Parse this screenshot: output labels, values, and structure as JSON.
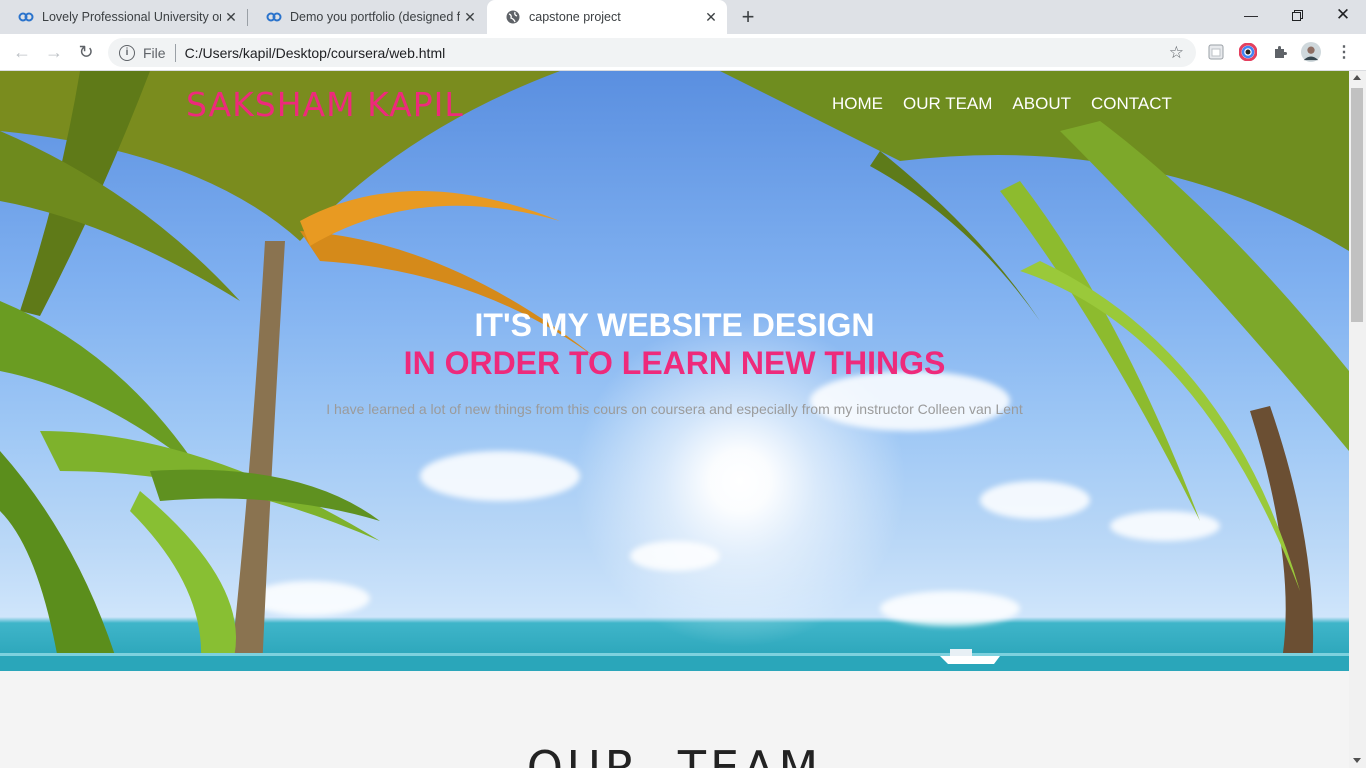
{
  "browser": {
    "tabs": [
      {
        "title": "Lovely Professional University on",
        "icon": "coursera-icon"
      },
      {
        "title": "Demo you portfolio (designed fro",
        "icon": "coursera-icon"
      },
      {
        "title": "capstone project",
        "icon": "globe-icon"
      }
    ],
    "new_tab_label": "+",
    "address": {
      "chip": "File",
      "url": "C:/Users/kapil/Desktop/coursera/web.html"
    }
  },
  "page": {
    "logo": "SAKSHAM KAPIL",
    "nav": [
      "HOME",
      "OUR TEAM",
      "ABOUT",
      "CONTACT"
    ],
    "headline": "IT'S MY WEBSITE DESIGN",
    "headline2": "IN ORDER TO LEARN NEW THINGS",
    "subtitle": "I have learned a lot of new things from this cours on coursera and especially from my instructor Colleen van Lent",
    "team_heading": "OUR  TEAM"
  },
  "colors": {
    "accent": "#ee2a7b",
    "tabstrip": "#dee1e6"
  }
}
